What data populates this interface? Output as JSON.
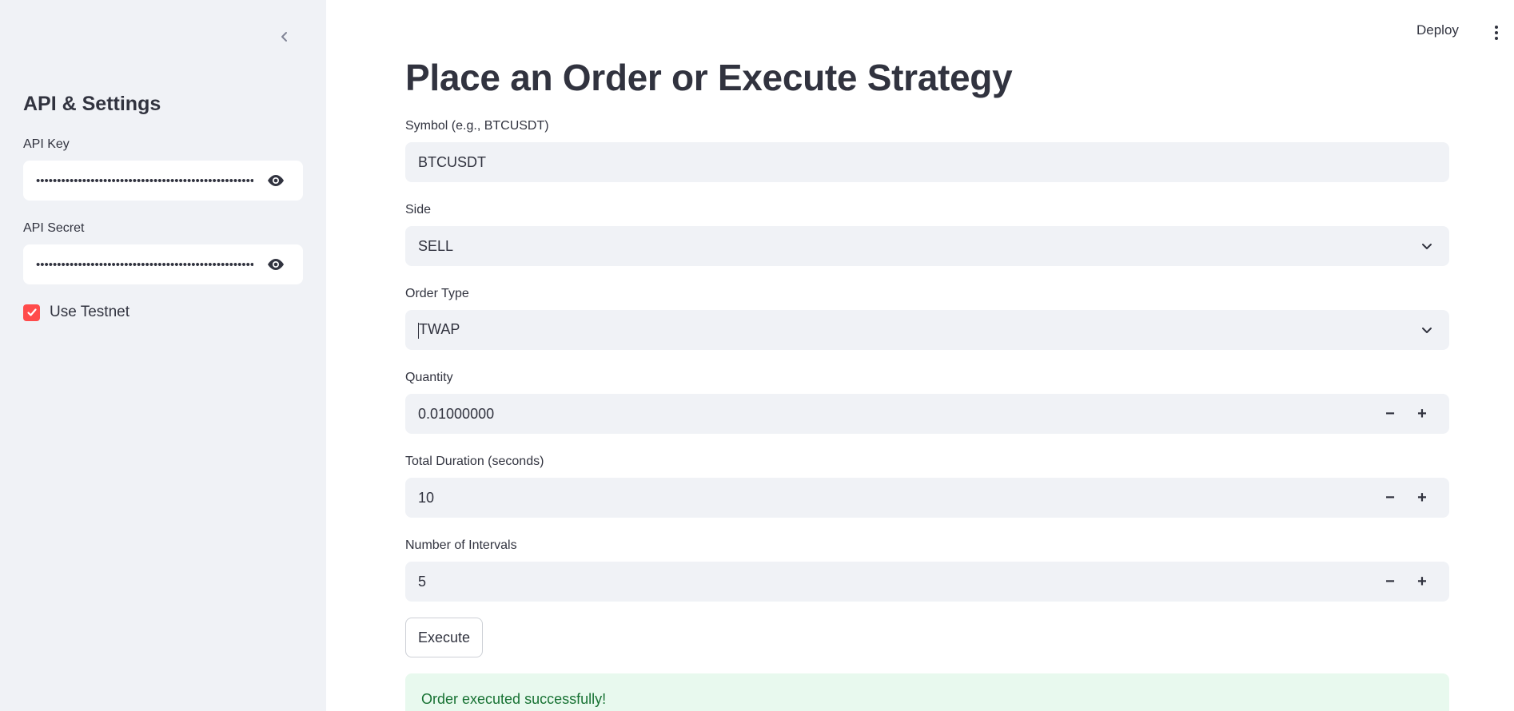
{
  "header": {
    "deploy_label": "Deploy",
    "more_icon": "vertical-ellipsis-icon"
  },
  "sidebar": {
    "collapse_icon": "chevron-left-icon",
    "heading": "API & Settings",
    "api_key": {
      "label": "API Key",
      "masked_value": "••••••••••••••••••••••••••••••••••••••••••••••••••••••"
    },
    "api_secret": {
      "label": "API Secret",
      "masked_value": "••••••••••••••••••••••••••••••••••••••••••••••••••••••"
    },
    "use_testnet": {
      "label": "Use Testnet",
      "checked": true
    }
  },
  "main": {
    "title": "Place an Order or Execute Strategy",
    "symbol": {
      "label": "Symbol (e.g., BTCUSDT)",
      "value": "BTCUSDT"
    },
    "side": {
      "label": "Side",
      "value": "SELL"
    },
    "order_type": {
      "label": "Order Type",
      "value": "TWAP"
    },
    "quantity": {
      "label": "Quantity",
      "value": "0.01000000"
    },
    "total_duration": {
      "label": "Total Duration (seconds)",
      "value": "10"
    },
    "num_intervals": {
      "label": "Number of Intervals",
      "value": "5"
    },
    "stepper": {
      "minus": "−",
      "plus": "+"
    },
    "execute_label": "Execute",
    "success_message": "Order executed successfully!"
  },
  "colors": {
    "accent": "#ff4b4b",
    "sidebar_bg": "#f0f2f6",
    "success_bg": "#e8f9ee",
    "success_text": "#177233"
  }
}
